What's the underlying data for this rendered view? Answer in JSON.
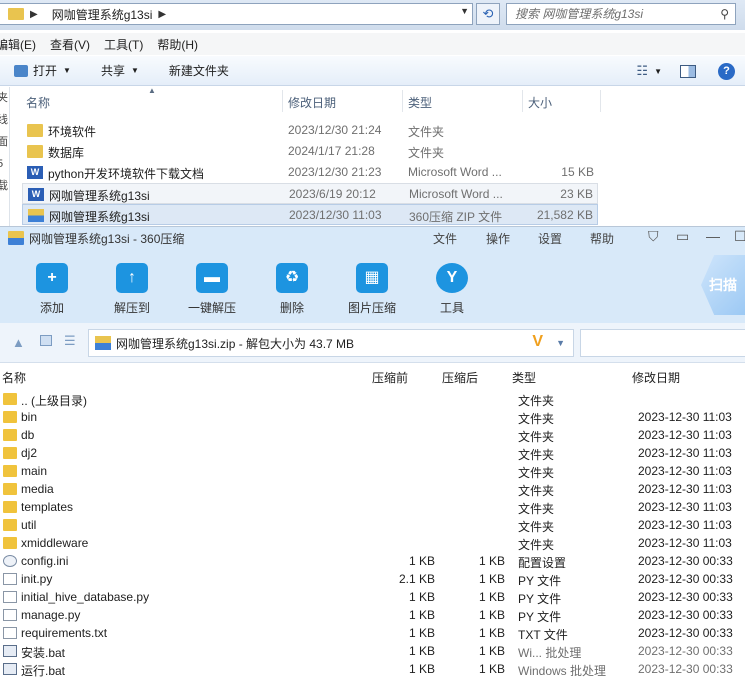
{
  "explorer": {
    "breadcrumb": "网咖管理系统g13si",
    "search_placeholder": "搜索 网咖管理系统g13si",
    "menu": [
      "编辑(E)",
      "查看(V)",
      "工具(T)",
      "帮助(H)"
    ],
    "toolbar": {
      "open": "打开",
      "share": "共享",
      "new_folder": "新建文件夹"
    },
    "left_nav": [
      "夹",
      "线",
      "面",
      "5",
      "载"
    ],
    "columns": {
      "name": "名称",
      "date": "修改日期",
      "type": "类型",
      "size": "大小"
    },
    "rows": [
      {
        "name": "环境软件",
        "date": "2023/12/30 21:24",
        "type": "文件夹",
        "size": "",
        "icon": "folder-icon"
      },
      {
        "name": "数据库",
        "date": "2024/1/17 21:28",
        "type": "文件夹",
        "size": "",
        "icon": "folder-icon"
      },
      {
        "name": "python开发环境软件下载文档",
        "date": "2023/12/30 21:23",
        "type": "Microsoft Word ...",
        "size": "15 KB",
        "icon": "word-doc-icon"
      },
      {
        "name": "网咖管理系统g13si",
        "date": "2023/6/19 20:12",
        "type": "Microsoft Word ...",
        "size": "23 KB",
        "icon": "word-doc-icon"
      },
      {
        "name": "网咖管理系统g13si",
        "date": "2023/12/30 11:03",
        "type": "360压缩 ZIP 文件",
        "size": "21,582 KB",
        "icon": "zip-archive-icon"
      }
    ]
  },
  "zip": {
    "title": "网咖管理系统g13si - 360压缩",
    "menu": [
      "文件",
      "操作",
      "设置",
      "帮助"
    ],
    "tools": [
      "添加",
      "解压到",
      "一键解压",
      "删除",
      "图片压缩",
      "工具"
    ],
    "scan_label": "扫描",
    "path": "网咖管理系统g13si.zip - 解包大小为 43.7 MB",
    "columns": {
      "name": "名称",
      "compressed": "压缩前",
      "after": "压缩后",
      "type": "类型",
      "date": "修改日期"
    },
    "rows": [
      {
        "name": ".. (上级目录)",
        "before": "",
        "after": "",
        "type": "文件夹",
        "date": "",
        "icon": "folder"
      },
      {
        "name": "bin",
        "before": "",
        "after": "",
        "type": "文件夹",
        "date": "2023-12-30 11:03",
        "icon": "folder"
      },
      {
        "name": "db",
        "before": "",
        "after": "",
        "type": "文件夹",
        "date": "2023-12-30 11:03",
        "icon": "folder"
      },
      {
        "name": "dj2",
        "before": "",
        "after": "",
        "type": "文件夹",
        "date": "2023-12-30 11:03",
        "icon": "folder"
      },
      {
        "name": "main",
        "before": "",
        "after": "",
        "type": "文件夹",
        "date": "2023-12-30 11:03",
        "icon": "folder"
      },
      {
        "name": "media",
        "before": "",
        "after": "",
        "type": "文件夹",
        "date": "2023-12-30 11:03",
        "icon": "folder"
      },
      {
        "name": "templates",
        "before": "",
        "after": "",
        "type": "文件夹",
        "date": "2023-12-30 11:03",
        "icon": "folder"
      },
      {
        "name": "util",
        "before": "",
        "after": "",
        "type": "文件夹",
        "date": "2023-12-30 11:03",
        "icon": "folder"
      },
      {
        "name": "xmiddleware",
        "before": "",
        "after": "",
        "type": "文件夹",
        "date": "2023-12-30 11:03",
        "icon": "folder"
      },
      {
        "name": "config.ini",
        "before": "1 KB",
        "after": "1 KB",
        "type": "配置设置",
        "date": "2023-12-30 00:33",
        "icon": "cfg"
      },
      {
        "name": "init.py",
        "before": "2.1 KB",
        "after": "1 KB",
        "type": "PY 文件",
        "date": "2023-12-30 00:33",
        "icon": "file"
      },
      {
        "name": "initial_hive_database.py",
        "before": "1 KB",
        "after": "1 KB",
        "type": "PY 文件",
        "date": "2023-12-30 00:33",
        "icon": "file"
      },
      {
        "name": "manage.py",
        "before": "1 KB",
        "after": "1 KB",
        "type": "PY 文件",
        "date": "2023-12-30 00:33",
        "icon": "file"
      },
      {
        "name": "requirements.txt",
        "before": "1 KB",
        "after": "1 KB",
        "type": "TXT 文件",
        "date": "2023-12-30 00:33",
        "icon": "file"
      },
      {
        "name": "安装.bat",
        "before": "1 KB",
        "after": "1 KB",
        "type": "Wi... 批处理",
        "date": "2023-12-30 00:33",
        "icon": "bat"
      },
      {
        "name": "运行.bat",
        "before": "1 KB",
        "after": "1 KB",
        "type": "Windows 批处理",
        "date": "2023-12-30 00:33",
        "icon": "bat"
      }
    ]
  }
}
